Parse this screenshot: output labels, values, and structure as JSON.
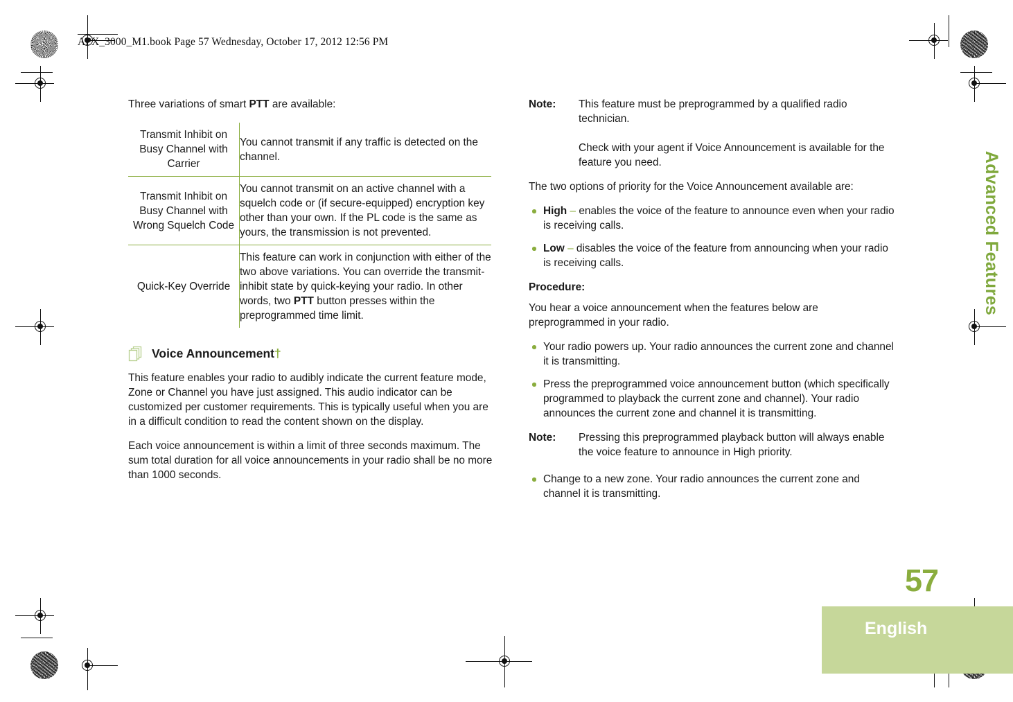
{
  "header": {
    "filestamp": "APX_3000_M1.book  Page 57  Wednesday, October 17, 2012  12:56 PM"
  },
  "side": {
    "chapter_tab": "Advanced Features",
    "page_number": "57",
    "language": "English"
  },
  "colors": {
    "accent_green": "#8aad3e",
    "tab_green": "#c6d79a",
    "chapter_green": "#7fa83c",
    "rule_green": "#8aad3e"
  },
  "left_column": {
    "intro": {
      "pre": "Three variations of smart ",
      "bold": "PTT",
      "post": " are available:"
    },
    "table": {
      "rows": [
        {
          "term": "Transmit Inhibit on Busy Channel with Carrier",
          "desc": "You cannot transmit if any traffic is detected on the channel."
        },
        {
          "term": "Transmit Inhibit on Busy Channel with Wrong Squelch Code",
          "desc": "You cannot transmit on an active channel with a squelch code or (if secure-equipped) encryption key other than your own. If the PL code is the same as yours, the transmission is not prevented."
        },
        {
          "term": "Quick-Key Override",
          "desc_pre": "This feature can work in conjunction with either of the two above variations. You can override the transmit-inhibit state by quick-keying your radio. In other words, two ",
          "desc_bold": "PTT",
          "desc_post": " button presses within the preprogrammed time limit."
        }
      ]
    },
    "section": {
      "icon": "stacked-pages-icon",
      "title": "Voice Announcement",
      "dagger": "†"
    },
    "paragraphs": [
      "This feature enables your radio to audibly indicate the current feature mode, Zone or Channel you have just assigned. This audio indicator can be customized per customer requirements. This is typically useful when you are in a difficult condition to read the content shown on the display.",
      "Each voice announcement is within a limit of three seconds maximum. The sum total duration for all voice announcements in your radio shall be no more than 1000 seconds."
    ]
  },
  "right_column": {
    "note_1": {
      "label": "Note:",
      "text_1": "This feature must be preprogrammed by a qualified radio technician.",
      "text_2": "Check with your agent if Voice Announcement is available for the feature you need."
    },
    "priority_intro": "The two options of priority for the Voice Announcement available are:",
    "priority_items": [
      {
        "bold": "High",
        "dash": "–",
        "text": " enables the voice of the feature to announce even when your radio is receiving calls."
      },
      {
        "bold": "Low",
        "dash": "–",
        "text": " disables the voice of the feature from announcing when your radio is receiving calls."
      }
    ],
    "procedure_heading": "Procedure:",
    "procedure_intro": "You hear a voice announcement when the features below are preprogrammed in your radio.",
    "procedure_items": [
      "Your radio powers up. Your radio announces the current zone and channel it is transmitting.",
      "Press the preprogrammed voice announcement button (which specifically programmed to playback the current zone and channel). Your radio announces the current zone and channel it is transmitting."
    ],
    "note_2": {
      "label": "Note:",
      "text": "Pressing this preprogrammed playback button will always enable the voice feature to announce in High priority."
    },
    "final_items": [
      "Change to a new zone. Your radio announces the current zone and channel it is transmitting."
    ]
  }
}
